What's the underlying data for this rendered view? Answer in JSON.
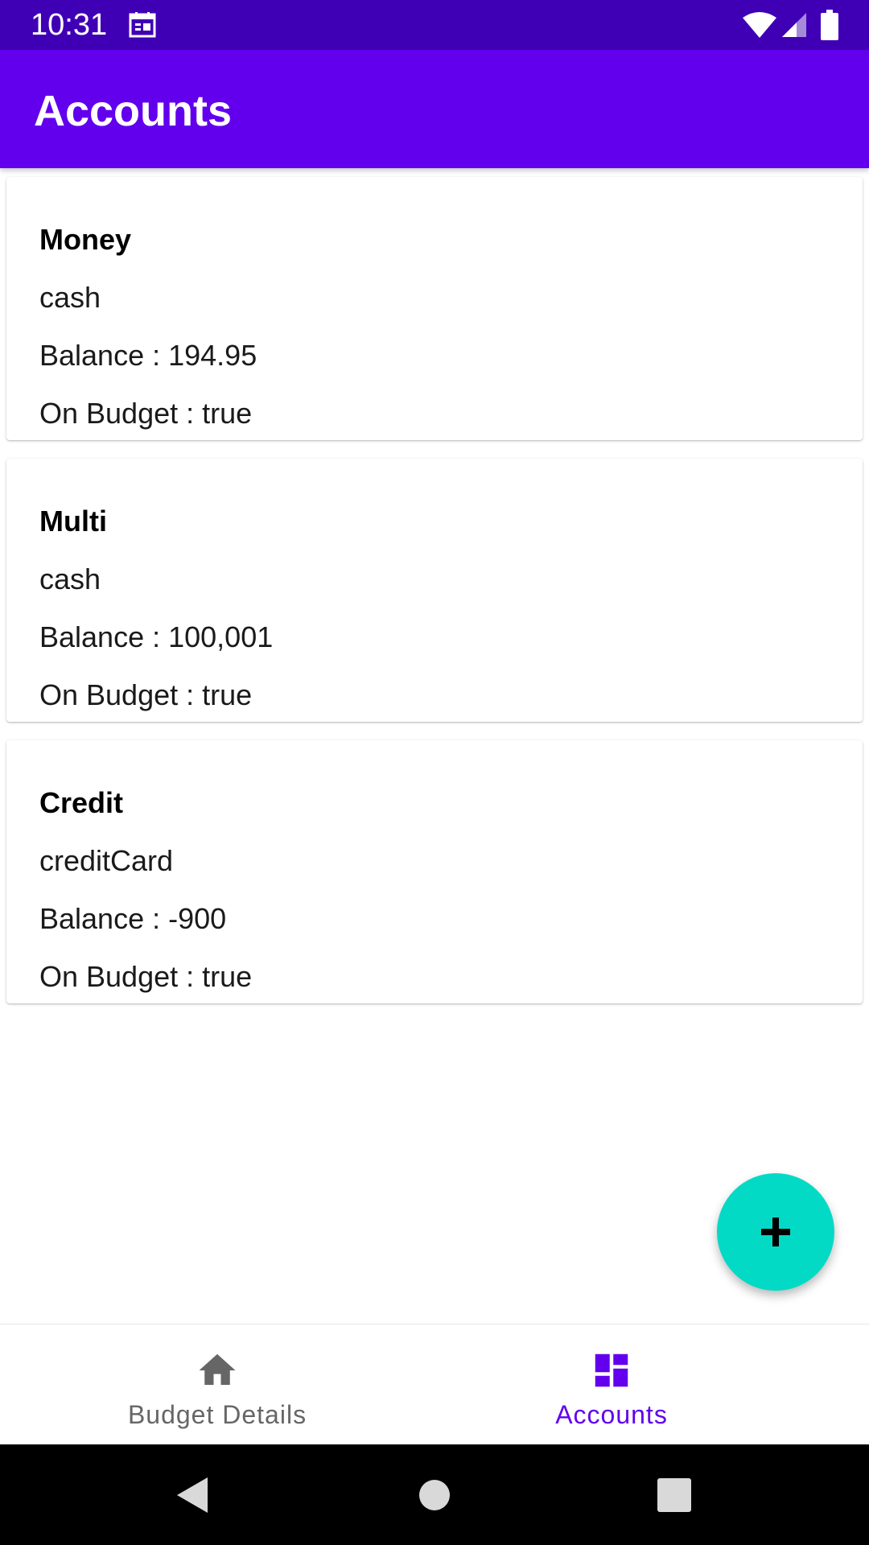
{
  "status_bar": {
    "time": "10:31",
    "background_color": "#3f00b5",
    "icons": [
      "calendar-icon",
      "wifi-icon",
      "cellular-signal-icon",
      "battery-icon"
    ]
  },
  "app_bar": {
    "title": "Accounts",
    "background_color": "#6200ee"
  },
  "accounts": [
    {
      "name": "Money",
      "type": "cash",
      "balance": "Balance : 194.95",
      "on_budget": "On Budget : true"
    },
    {
      "name": "Multi",
      "type": "cash",
      "balance": "Balance : 100,001",
      "on_budget": "On Budget : true"
    },
    {
      "name": "Credit",
      "type": "creditCard",
      "balance": "Balance : -900",
      "on_budget": "On Budget : true"
    }
  ],
  "fab": {
    "icon": "plus-icon",
    "color": "#03dac5"
  },
  "bottom_nav": {
    "items": [
      {
        "label": "Budget Details",
        "icon": "home-icon",
        "selected": false,
        "color": "#666666"
      },
      {
        "label": "Accounts",
        "icon": "dashboard-icon",
        "selected": true,
        "color": "#6200ee"
      }
    ]
  },
  "system_nav": {
    "buttons": [
      "back-icon",
      "home-circle-icon",
      "recents-icon"
    ]
  }
}
